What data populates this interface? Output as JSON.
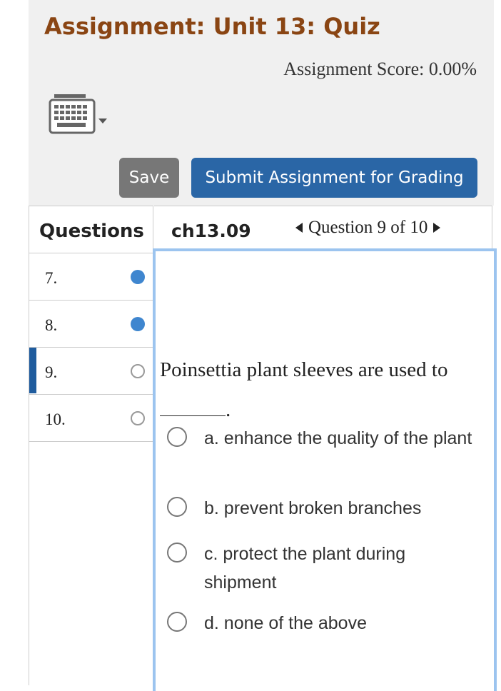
{
  "header": {
    "title": "Assignment: Unit 13: Quiz",
    "score": "Assignment Score: 0.00%",
    "keyboard_icon": "keyboard-icon",
    "save_label": "Save",
    "submit_label": "Submit Assignment for Grading"
  },
  "questions_panel": {
    "heading": "Questions",
    "items": [
      {
        "number": "7.",
        "status": "answered"
      },
      {
        "number": "8.",
        "status": "answered"
      },
      {
        "number": "9.",
        "status": "unanswered",
        "active": true
      },
      {
        "number": "10.",
        "status": "unanswered"
      }
    ]
  },
  "question": {
    "code": "ch13.09",
    "nav_label": "Question 9 of 10",
    "prompt": "Poinsettia plant sleeves are used to",
    "prompt_end": ".",
    "choices": [
      {
        "label": "a. enhance the quality of the plant"
      },
      {
        "label": "b. prevent broken branches"
      },
      {
        "label": "c. protect the plant during shipment"
      },
      {
        "label": "d. none of the above"
      }
    ]
  },
  "colors": {
    "title": "#8a4513",
    "submit_button": "#2a66a6",
    "save_button": "#777777",
    "answered_dot": "#3f86cf",
    "active_marker": "#1f5c9e",
    "content_border": "#9cc4ef"
  }
}
